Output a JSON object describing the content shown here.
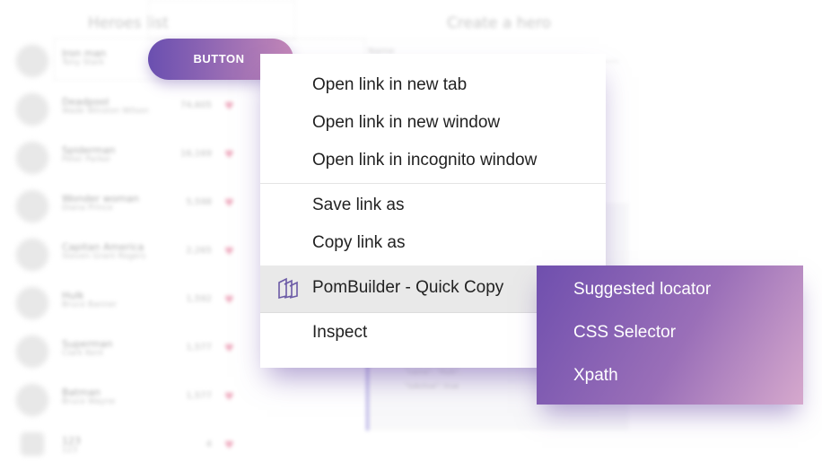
{
  "background": {
    "heroes_list_title": "Heroes list",
    "create_hero_title": "Create a hero",
    "name_label": "Name",
    "heroes": [
      {
        "name": "Iron man",
        "real_name": "Tony Stark",
        "likes": ""
      },
      {
        "name": "Deadpool",
        "real_name": "Wade Winston Wilson",
        "likes": "74,605"
      },
      {
        "name": "Spiderman",
        "real_name": "Peter Parker",
        "likes": "16,169"
      },
      {
        "name": "Wonder woman",
        "real_name": "Diana Prince",
        "likes": "5,598"
      },
      {
        "name": "Capitan America",
        "real_name": "Steven Grant Rogers",
        "likes": "2,265"
      },
      {
        "name": "Hulk",
        "real_name": "Bruce Banner",
        "likes": "1,592"
      },
      {
        "name": "Superman",
        "real_name": "Clark Kent",
        "likes": "1,577"
      },
      {
        "name": "Batman",
        "real_name": "Bruce Wayne",
        "likes": "1,577"
      },
      {
        "name": "123",
        "real_name": "123",
        "likes": "4"
      }
    ],
    "code_lines": [
      "\"name\": \"Hulk\",",
      "\"isActive\": true"
    ],
    "heart_icon": "heart-icon",
    "accent": "#7a6fd0"
  },
  "button": {
    "label": "BUTTON"
  },
  "context_menu": {
    "items": [
      {
        "label": "Open link in new tab"
      },
      {
        "label": "Open link in new window"
      },
      {
        "label": "Open link in incognito window"
      },
      {
        "label": "Save link as"
      },
      {
        "label": "Copy link as"
      },
      {
        "label": "PomBuilder - Quick Copy",
        "icon": "pombuilder-icon"
      },
      {
        "label": "Inspect"
      }
    ]
  },
  "submenu": {
    "items": [
      {
        "label": "Suggested locator"
      },
      {
        "label": "CSS Selector"
      },
      {
        "label": "Xpath"
      }
    ]
  },
  "colors": {
    "gradient_start": "#6f4fae",
    "gradient_end": "#d6a9cd",
    "menu_hover": "#e9e9e9"
  }
}
